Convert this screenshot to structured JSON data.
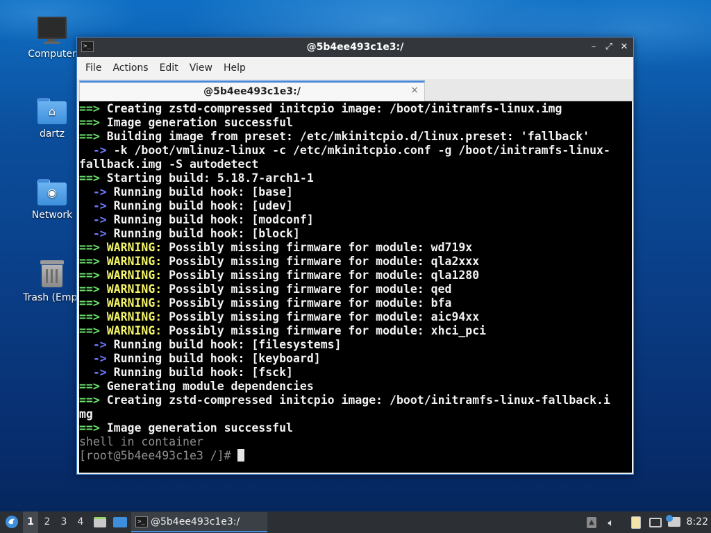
{
  "desktop": {
    "icons": [
      {
        "label": "Computer",
        "icon": "computer-icon"
      },
      {
        "label": "dartz",
        "icon": "home-folder-icon"
      },
      {
        "label": "Network",
        "icon": "network-folder-icon"
      },
      {
        "label": "Trash (Empt",
        "icon": "trash-icon"
      }
    ]
  },
  "window": {
    "title": "@5b4ee493c1e3:/",
    "menu": [
      "File",
      "Actions",
      "Edit",
      "View",
      "Help"
    ],
    "tab_title": "@5b4ee493c1e3:/",
    "tab_close": "×",
    "controls": {
      "minimize": "–",
      "maximize": "⤢",
      "close": "✕"
    }
  },
  "terminal": {
    "lines": [
      {
        "kind": "step",
        "prefix": "==>",
        "text": " Creating zstd-compressed initcpio image: /boot/initramfs-linux.img"
      },
      {
        "kind": "step",
        "prefix": "==>",
        "text": " Image generation successful"
      },
      {
        "kind": "step",
        "prefix": "==>",
        "text": " Building image from preset: /etc/mkinitcpio.d/linux.preset: 'fallback'"
      },
      {
        "kind": "sub",
        "prefix": "  ->",
        "text": " -k /boot/vmlinuz-linux -c /etc/mkinitcpio.conf -g /boot/initramfs-linux-"
      },
      {
        "kind": "plain",
        "prefix": "",
        "text": "fallback.img -S autodetect"
      },
      {
        "kind": "step",
        "prefix": "==>",
        "text": " Starting build: 5.18.7-arch1-1"
      },
      {
        "kind": "sub",
        "prefix": "  ->",
        "text": " Running build hook: [base]"
      },
      {
        "kind": "sub",
        "prefix": "  ->",
        "text": " Running build hook: [udev]"
      },
      {
        "kind": "sub",
        "prefix": "  ->",
        "text": " Running build hook: [modconf]"
      },
      {
        "kind": "sub",
        "prefix": "  ->",
        "text": " Running build hook: [block]"
      },
      {
        "kind": "warn",
        "prefix": "==>",
        "label": " WARNING:",
        "text": " Possibly missing firmware for module: wd719x"
      },
      {
        "kind": "warn",
        "prefix": "==>",
        "label": " WARNING:",
        "text": " Possibly missing firmware for module: qla2xxx"
      },
      {
        "kind": "warn",
        "prefix": "==>",
        "label": " WARNING:",
        "text": " Possibly missing firmware for module: qla1280"
      },
      {
        "kind": "warn",
        "prefix": "==>",
        "label": " WARNING:",
        "text": " Possibly missing firmware for module: qed"
      },
      {
        "kind": "warn",
        "prefix": "==>",
        "label": " WARNING:",
        "text": " Possibly missing firmware for module: bfa"
      },
      {
        "kind": "warn",
        "prefix": "==>",
        "label": " WARNING:",
        "text": " Possibly missing firmware for module: aic94xx"
      },
      {
        "kind": "warn",
        "prefix": "==>",
        "label": " WARNING:",
        "text": " Possibly missing firmware for module: xhci_pci"
      },
      {
        "kind": "sub",
        "prefix": "  ->",
        "text": " Running build hook: [filesystems]"
      },
      {
        "kind": "sub",
        "prefix": "  ->",
        "text": " Running build hook: [keyboard]"
      },
      {
        "kind": "sub",
        "prefix": "  ->",
        "text": " Running build hook: [fsck]"
      },
      {
        "kind": "step",
        "prefix": "==>",
        "text": " Generating module dependencies"
      },
      {
        "kind": "step",
        "prefix": "==>",
        "text": " Creating zstd-compressed initcpio image: /boot/initramfs-linux-fallback.i"
      },
      {
        "kind": "plain-bold",
        "prefix": "",
        "text": "mg"
      },
      {
        "kind": "step",
        "prefix": "==>",
        "text": " Image generation successful"
      },
      {
        "kind": "dim",
        "prefix": "",
        "text": "shell in container"
      }
    ],
    "prompt": "[root@5b4ee493c1e3 /]# "
  },
  "taskbar": {
    "workspaces": [
      "1",
      "2",
      "3",
      "4"
    ],
    "active_workspace": "1",
    "task_label": "@5b4ee493c1e3:/",
    "clock": "8:22"
  },
  "colors": {
    "accent": "#4a8ad8",
    "step_arrow": "#6ee36e",
    "sub_arrow": "#6d7bff",
    "warning": "#f5f56a"
  }
}
